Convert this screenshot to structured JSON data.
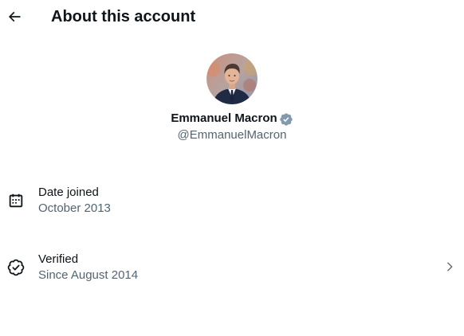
{
  "header": {
    "title": "About this account",
    "back_icon": "arrow-left-icon"
  },
  "profile": {
    "display_name": "Emmanuel Macron",
    "handle": "@EmmanuelMacron",
    "verified_badge_icon": "verified-badge-icon",
    "badge_color": "#829aab"
  },
  "details": {
    "date_joined": {
      "icon": "calendar-icon",
      "label": "Date joined",
      "value": "October 2013"
    },
    "verified": {
      "icon": "verified-check-icon",
      "label": "Verified",
      "value": "Since August 2014",
      "chevron_icon": "chevron-right-icon"
    }
  },
  "colors": {
    "primary_text": "#0f1419",
    "secondary_text": "#536471",
    "background": "#ffffff"
  }
}
